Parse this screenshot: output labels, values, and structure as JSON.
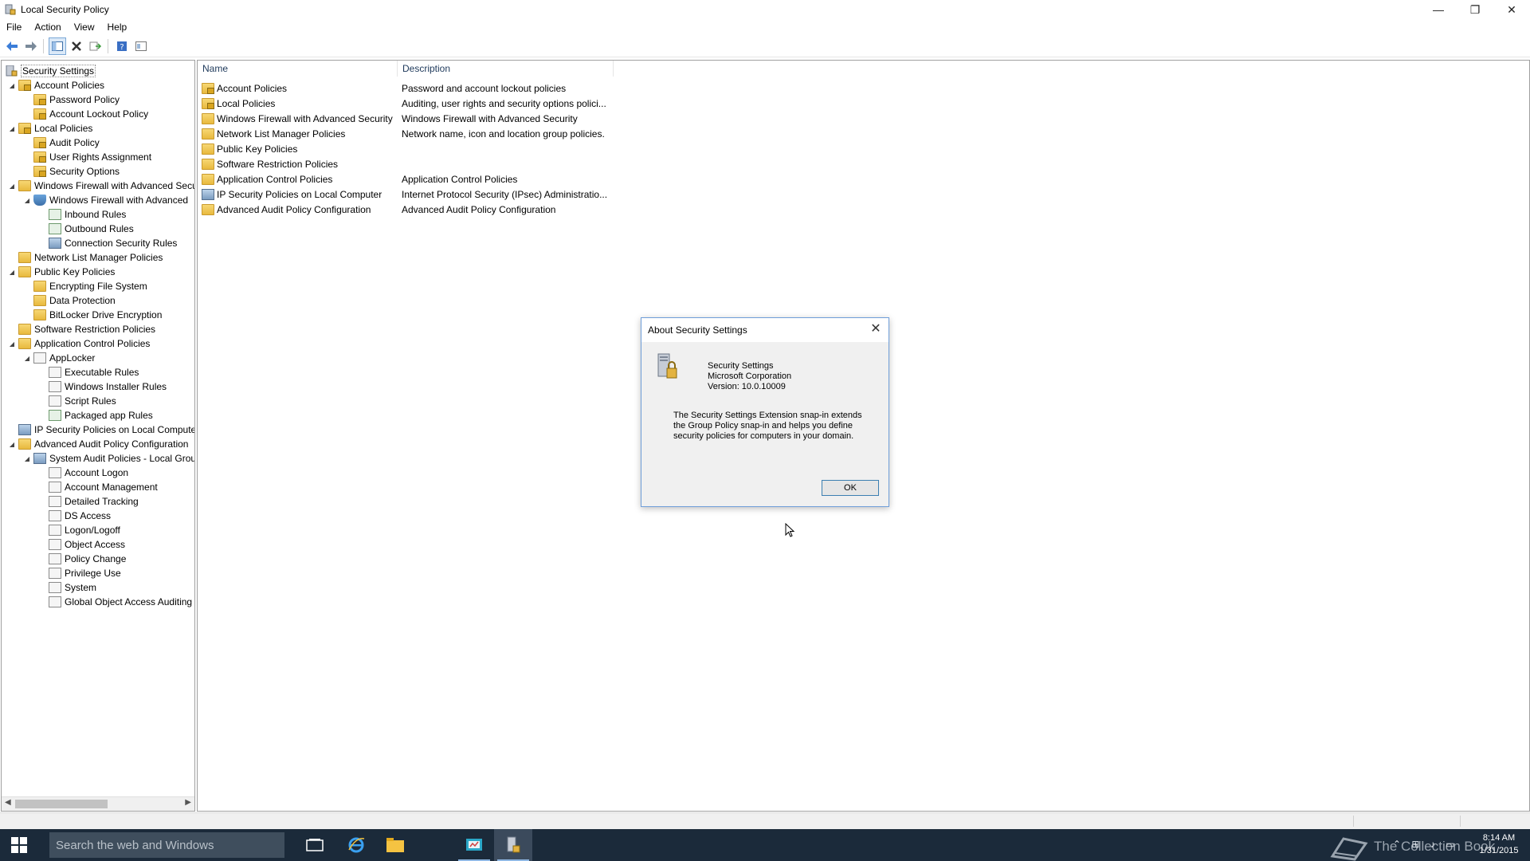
{
  "window": {
    "title": "Local Security Policy",
    "minimize": "—",
    "maximize": "❐",
    "close": "✕"
  },
  "menu": {
    "file": "File",
    "action": "Action",
    "view": "View",
    "help": "Help"
  },
  "tree": {
    "root": "Security Settings",
    "items": [
      "Account Policies",
      "Password Policy",
      "Account Lockout Policy",
      "Local Policies",
      "Audit Policy",
      "User Rights Assignment",
      "Security Options",
      "Windows Firewall with Advanced Secu",
      "Windows Firewall with Advanced",
      "Inbound Rules",
      "Outbound Rules",
      "Connection Security Rules",
      "Network List Manager Policies",
      "Public Key Policies",
      "Encrypting File System",
      "Data Protection",
      "BitLocker Drive Encryption",
      "Software Restriction Policies",
      "Application Control Policies",
      "AppLocker",
      "Executable Rules",
      "Windows Installer Rules",
      "Script Rules",
      "Packaged app Rules",
      "IP Security Policies on Local Compute",
      "Advanced Audit Policy Configuration",
      "System Audit Policies - Local Grou",
      "Account Logon",
      "Account Management",
      "Detailed Tracking",
      "DS Access",
      "Logon/Logoff",
      "Object Access",
      "Policy Change",
      "Privilege Use",
      "System",
      "Global Object Access Auditing"
    ]
  },
  "list": {
    "columns": {
      "name": "Name",
      "description": "Description"
    },
    "rows": [
      {
        "name": "Account Policies",
        "description": "Password and account lockout policies"
      },
      {
        "name": "Local Policies",
        "description": "Auditing, user rights and security options polici..."
      },
      {
        "name": "Windows Firewall with Advanced Security",
        "description": "Windows Firewall with Advanced Security"
      },
      {
        "name": "Network List Manager Policies",
        "description": "Network name, icon and location group policies."
      },
      {
        "name": "Public Key Policies",
        "description": ""
      },
      {
        "name": "Software Restriction Policies",
        "description": ""
      },
      {
        "name": "Application Control Policies",
        "description": "Application Control Policies"
      },
      {
        "name": "IP Security Policies on Local Computer",
        "description": "Internet Protocol Security (IPsec) Administratio..."
      },
      {
        "name": "Advanced Audit Policy Configuration",
        "description": "Advanced Audit Policy Configuration"
      }
    ]
  },
  "dialog": {
    "title": "About Security Settings",
    "close": "✕",
    "product": "Security Settings",
    "company": "Microsoft Corporation",
    "version": "Version: 10.0.10009",
    "description": "The Security Settings Extension snap-in extends the Group Policy snap-in and helps you define security policies for computers in your domain.",
    "ok": "OK"
  },
  "taskbar": {
    "search_placeholder": "Search the web and Windows",
    "watermark": "The Collection Book",
    "time": "8:14 AM",
    "date": "1/31/2015"
  },
  "colors": {
    "taskbar": "#1b2a3a",
    "dialog_border": "#6f9ed9",
    "folder": "#e8b93e"
  }
}
